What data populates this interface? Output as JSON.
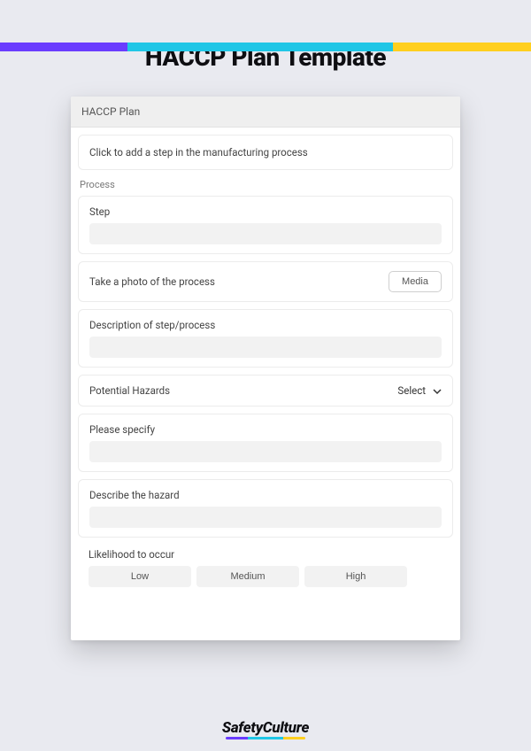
{
  "page_title": "HACCP Plan Template",
  "card": {
    "header": "HACCP Plan",
    "add_step_hint": "Click to add a step in the manufacturing process",
    "process_subheader": "Process",
    "step_label": "Step",
    "step_value": "",
    "photo_label": "Take a photo of the process",
    "media_button": "Media",
    "description_label": "Description of step/process",
    "description_value": "",
    "hazards_label": "Potential Hazards",
    "hazards_select_value": "Select",
    "specify_label": "Please specify",
    "specify_value": "",
    "describe_hazard_label": "Describe the hazard",
    "describe_hazard_value": "",
    "likelihood_label": "Likelihood to occur",
    "likelihood_options": [
      "Low",
      "Medium",
      "High"
    ]
  },
  "brand": "SafetyCulture",
  "colors": {
    "purple": "#6a3cff",
    "cyan": "#20c6e6",
    "yellow": "#ffcf1f",
    "page_bg": "#e9eaf0"
  }
}
